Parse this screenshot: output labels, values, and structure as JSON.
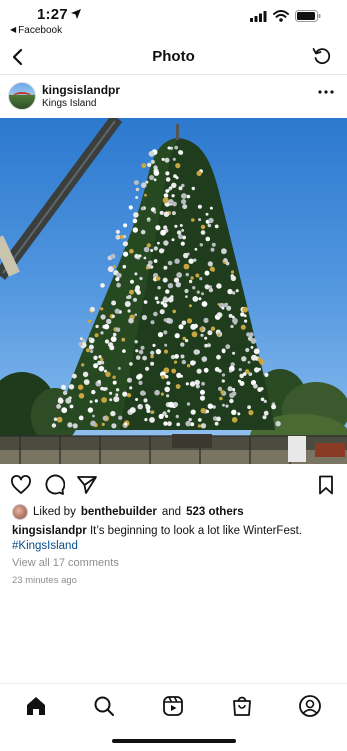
{
  "status_bar": {
    "time": "1:27",
    "back_app_label": "Facebook"
  },
  "nav": {
    "title": "Photo"
  },
  "post": {
    "username": "kingsislandpr",
    "location": "Kings Island",
    "likes": {
      "prefix": "Liked by",
      "liker": "benthebuilder",
      "conjunction": "and",
      "others": "523 others"
    },
    "caption": {
      "username": "kingsislandpr",
      "text": "It’s beginning to look a lot like WinterFest.",
      "hashtag": "#KingsIsland"
    },
    "view_comments": "View all 17 comments",
    "timestamp": "23 minutes ago"
  },
  "colors": {
    "hashtag": "#0b4d8a",
    "muted_text": "#8e8e8e",
    "sky_top": "#2c79cf",
    "tree_green": "#1f3d1c"
  },
  "icons": {
    "nav": [
      "chevron-left-icon",
      "refresh-icon"
    ],
    "post": [
      "more-dots-icon"
    ],
    "actions": [
      "heart-icon",
      "comment-icon",
      "share-icon",
      "bookmark-icon"
    ],
    "tabs": [
      "home-icon",
      "search-icon",
      "reels-icon",
      "shop-icon",
      "profile-icon"
    ]
  }
}
